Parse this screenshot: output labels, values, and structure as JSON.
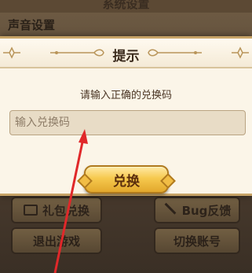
{
  "background": {
    "title": "系统设置",
    "section_label": "声音设置",
    "buttons": {
      "gift": "礼包兑换",
      "bug": "Bug反馈",
      "quit": "退出游戏",
      "switch_account": "切换账号"
    }
  },
  "dialog": {
    "title": "提示",
    "message": "请输入正确的兑换码",
    "input_placeholder": "输入兑换码",
    "input_value": "",
    "confirm_label": "兑换"
  },
  "annotation": {
    "arrow_color": "#e0282a"
  }
}
